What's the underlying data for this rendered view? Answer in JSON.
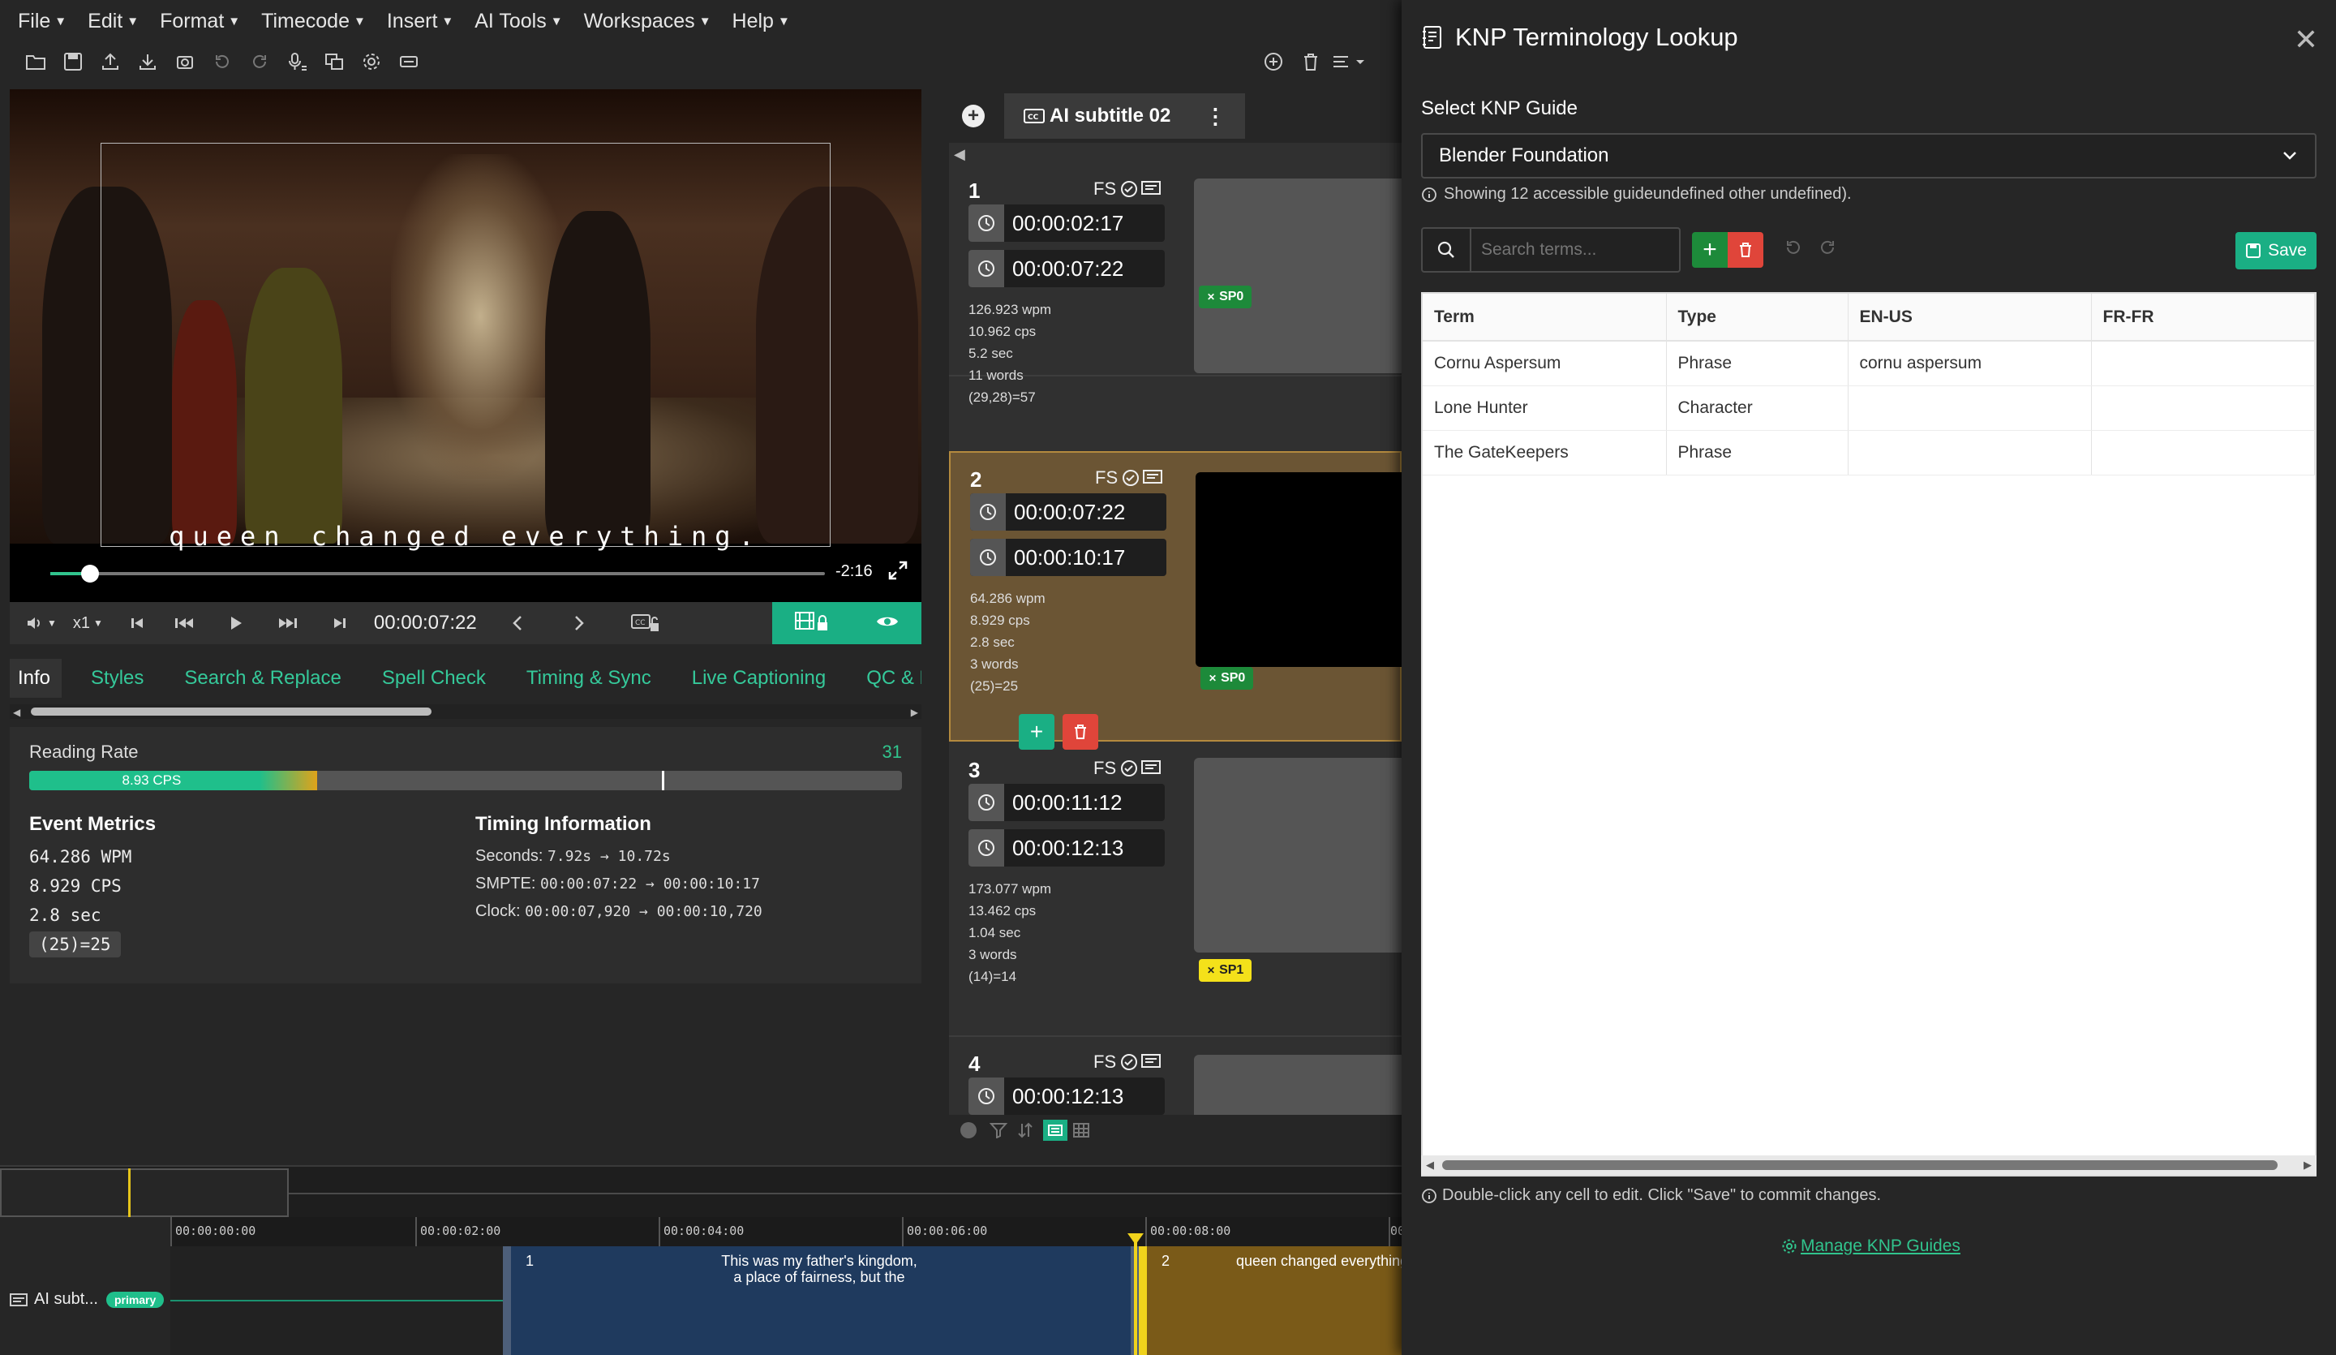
{
  "menubar": [
    "File",
    "Edit",
    "Format",
    "Timecode",
    "Insert",
    "AI Tools",
    "Workspaces",
    "Help"
  ],
  "player": {
    "subtitle_text": "queen changed everything.",
    "remaining": "-2:16",
    "speed": "x1",
    "current_time": "00:00:07:22"
  },
  "tabs": [
    "Info",
    "Styles",
    "Search & Replace",
    "Spell Check",
    "Timing & Sync",
    "Live Captioning",
    "QC & Re"
  ],
  "info": {
    "reading_rate_label": "Reading Rate",
    "reading_rate_value": "31",
    "cps_bar_label": "8.93 CPS",
    "cps_fraction": 0.33,
    "marker_fraction": 0.725,
    "event_metrics_title": "Event Metrics",
    "wpm": "64.286 WPM",
    "cps": "8.929 CPS",
    "duration": "2.8 sec",
    "chars": "(25)=25",
    "timing_title": "Timing Information",
    "seconds_label": "Seconds:",
    "seconds_value": "7.92s → 10.72s",
    "smpte_label": "SMPTE:",
    "smpte_value": "00:00:07:22 → 00:00:10:17",
    "clock_label": "Clock:",
    "clock_value": "00:00:07,920 → 00:00:10,720"
  },
  "subtitle_list": {
    "tab_label": "AI subtitle 02",
    "events": [
      {
        "num": "1",
        "fs": "FS",
        "start": "00:00:02:17",
        "end": "00:00:07:22",
        "wpm": "126.923 wpm",
        "cps": "10.962 cps",
        "sec": "5.2 sec",
        "words": "11 words",
        "chars": "(29,28)=57",
        "speaker": "SP0"
      },
      {
        "num": "2",
        "fs": "FS",
        "start": "00:00:07:22",
        "end": "00:00:10:17",
        "wpm": "64.286 wpm",
        "cps": "8.929 cps",
        "sec": "2.8 sec",
        "words": "3 words",
        "chars": "(25)=25",
        "speaker": "SP0"
      },
      {
        "num": "3",
        "fs": "FS",
        "start": "00:00:11:12",
        "end": "00:00:12:13",
        "wpm": "173.077 wpm",
        "cps": "13.462 cps",
        "sec": "1.04 sec",
        "words": "3 words",
        "chars": "(14)=14",
        "speaker": "SP1"
      },
      {
        "num": "4",
        "fs": "FS",
        "start": "00:00:12:13"
      }
    ]
  },
  "timeline": {
    "ruler": [
      "00:00:00:00",
      "00:00:02:00",
      "00:00:04:00",
      "00:00:06:00",
      "00:00:08:00",
      "00"
    ],
    "track_name": "AI subt...",
    "track_badge": "primary",
    "block1_num": "1",
    "block1_text_line1": "This was my father's kingdom,",
    "block1_text_line2": "a place of fairness, but the",
    "block2_num": "2",
    "block2_text": "queen changed everything"
  },
  "knp": {
    "title": "KNP Terminology Lookup",
    "select_label": "Select KNP Guide",
    "selected_guide": "Blender Foundation",
    "info_text": "Showing 12 accessible guideundefined other undefined).",
    "search_placeholder": "Search terms...",
    "save_label": "Save",
    "columns": [
      "Term",
      "Type",
      "EN-US",
      "FR-FR"
    ],
    "rows": [
      [
        "Cornu Aspersum",
        "Phrase",
        "cornu aspersum",
        ""
      ],
      [
        "Lone Hunter",
        "Character",
        "",
        ""
      ],
      [
        "The GateKeepers",
        "Phrase",
        "",
        ""
      ]
    ],
    "hint": "Double-click any cell to edit. Click \"Save\" to commit changes.",
    "manage_link": "Manage KNP Guides"
  }
}
